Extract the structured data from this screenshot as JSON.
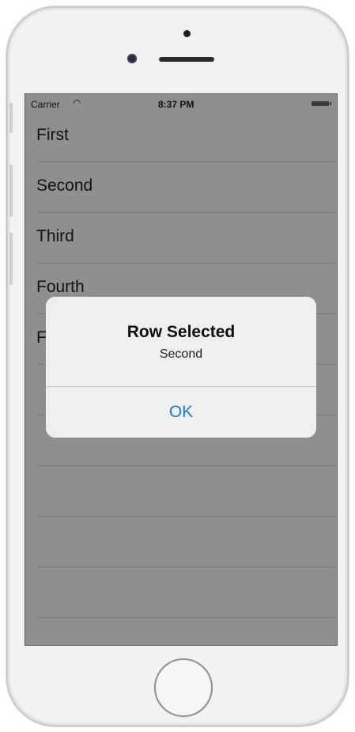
{
  "status_bar": {
    "carrier": "Carrier",
    "wifi_icon": "wifi-icon",
    "time": "8:37 PM",
    "battery_icon": "battery-icon"
  },
  "table": {
    "rows": [
      {
        "label": "First"
      },
      {
        "label": "Second"
      },
      {
        "label": "Third"
      },
      {
        "label": "Fourth"
      },
      {
        "label": "F"
      },
      {
        "label": ""
      },
      {
        "label": ""
      },
      {
        "label": ""
      },
      {
        "label": ""
      },
      {
        "label": ""
      }
    ]
  },
  "alert": {
    "title": "Row Selected",
    "message": "Second",
    "ok_label": "OK"
  },
  "colors": {
    "accent": "#1a7be0",
    "dim_overlay": "#8f8f8f"
  }
}
